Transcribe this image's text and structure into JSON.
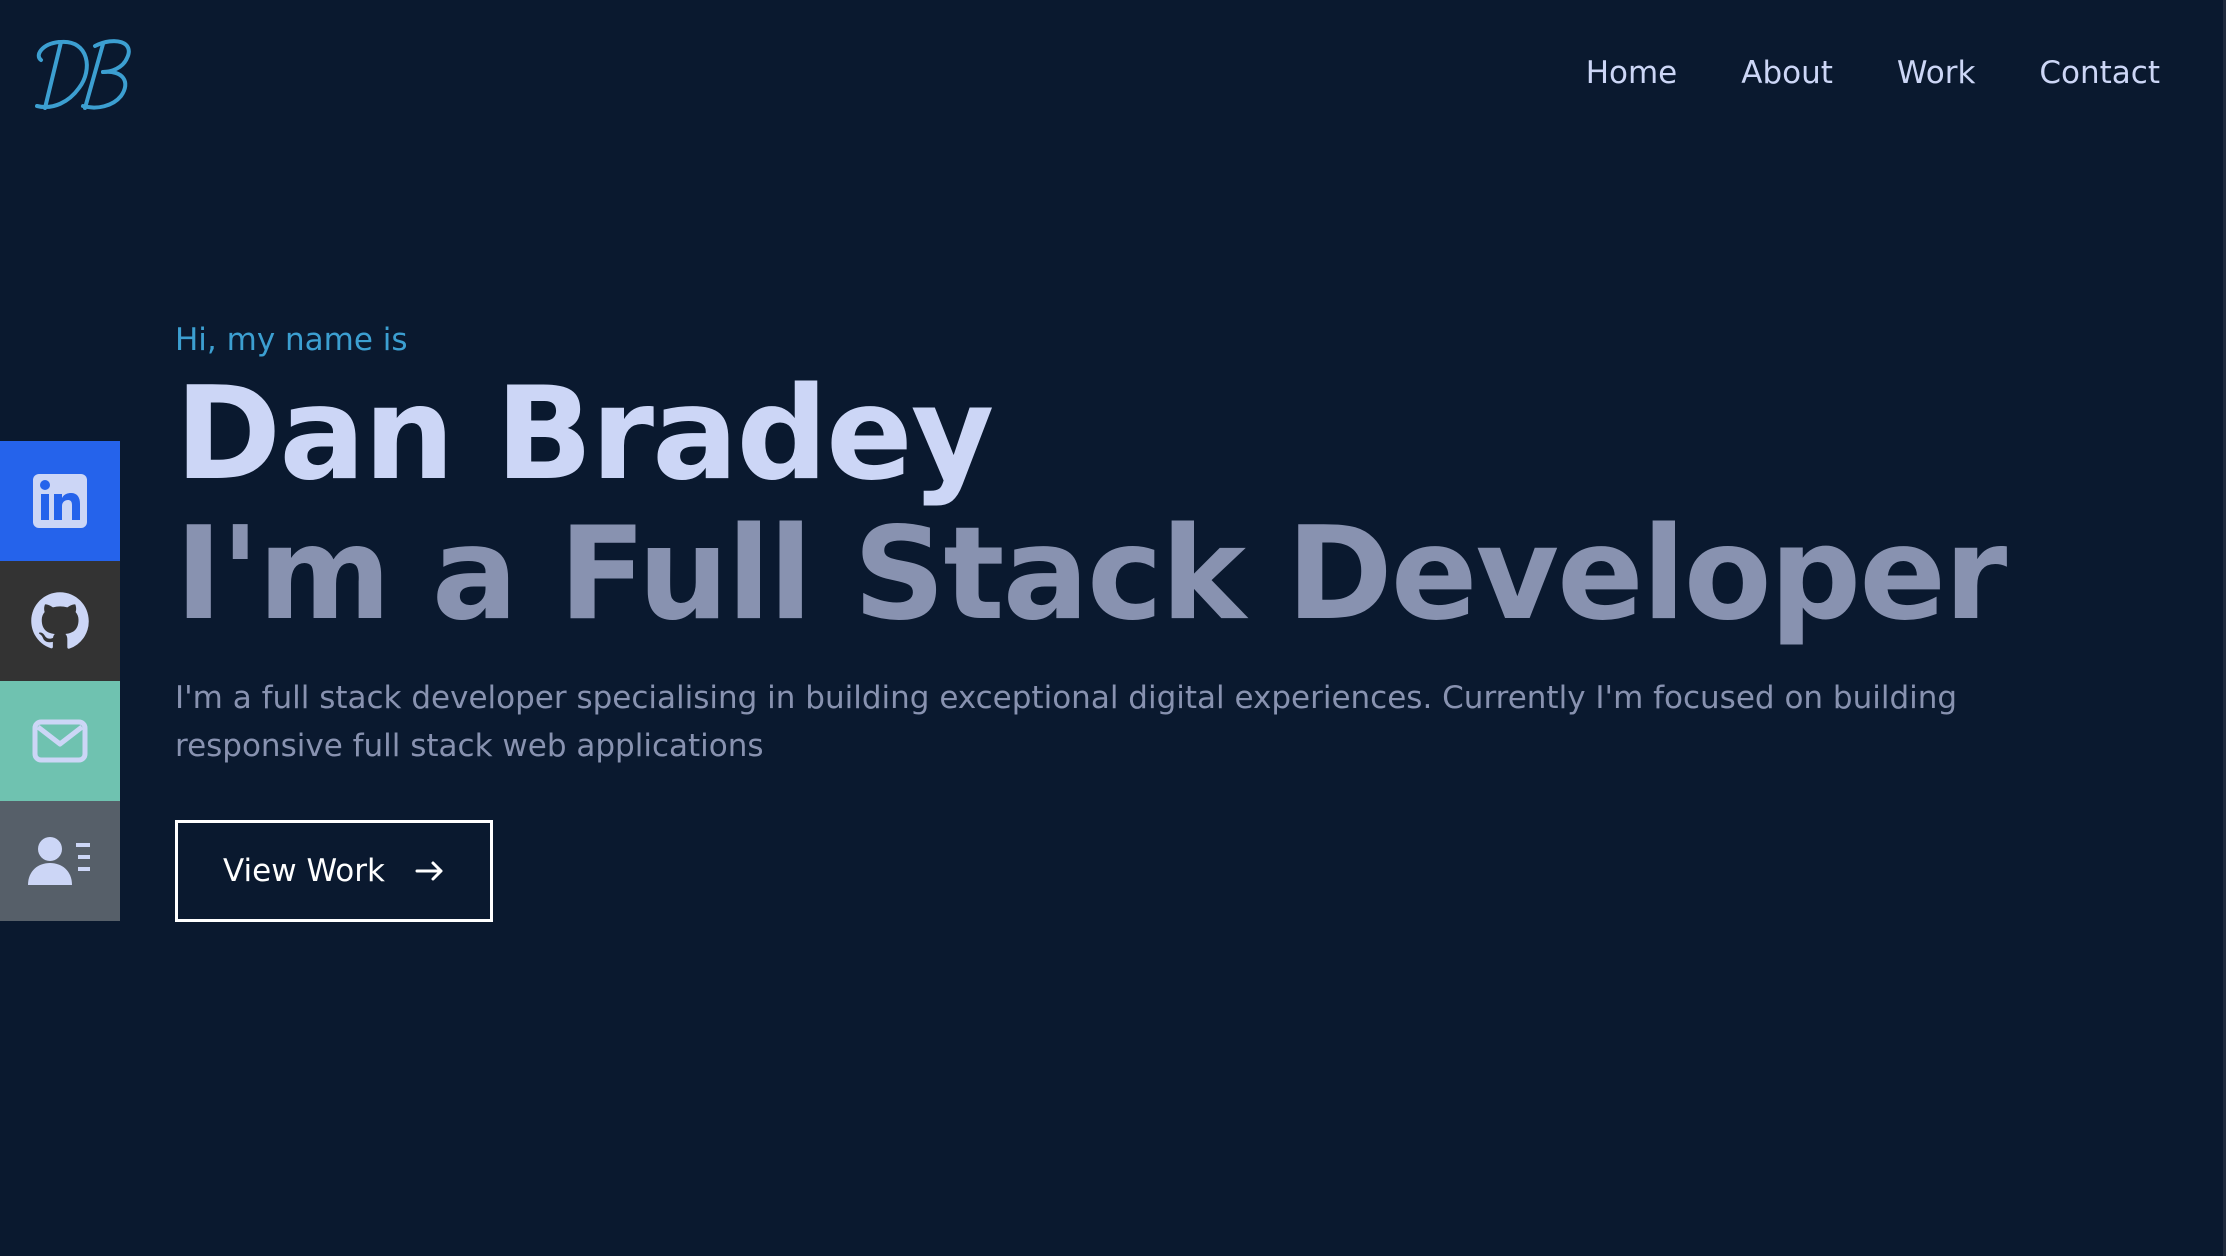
{
  "header": {
    "logo_text": "DB",
    "nav": [
      "Home",
      "About",
      "Work",
      "Contact"
    ]
  },
  "social": [
    {
      "name": "linkedin",
      "icon": "linkedin-icon",
      "color": "#2563eb"
    },
    {
      "name": "github",
      "icon": "github-icon",
      "color": "#333333"
    },
    {
      "name": "email",
      "icon": "mail-icon",
      "color": "#6fc2b0"
    },
    {
      "name": "resume",
      "icon": "contact-card-icon",
      "color": "#565f69"
    }
  ],
  "hero": {
    "greeting": "Hi, my name is",
    "name": "Dan Bradey",
    "tagline": "I'm a Full Stack Developer",
    "description": "I'm a full stack developer specialising in building exceptional digital experiences. Currently I'm focused on building responsive full stack web applications",
    "cta_label": "View Work",
    "cta_icon": "arrow-right-icon"
  },
  "colors": {
    "background": "#0a192f",
    "accent": "#3c9fd1",
    "heading": "#ccd6f6",
    "muted": "#8892b0"
  }
}
